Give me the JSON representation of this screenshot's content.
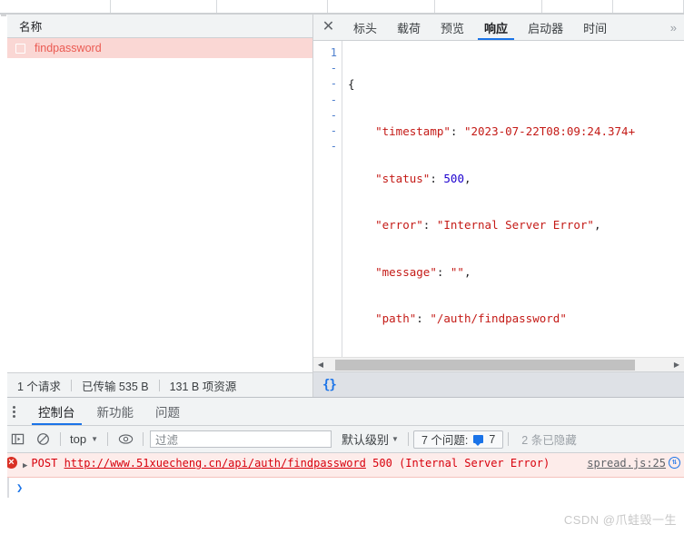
{
  "network_panel": {
    "request_list": {
      "column_header": "名称",
      "rows": [
        {
          "name": "findpassword",
          "icon": "document-icon",
          "selected": true
        }
      ]
    },
    "status_bar": {
      "requests": "1 个请求",
      "transferred": "已传输 535 B",
      "resources": "131 B 项资源"
    },
    "detail_tabs": {
      "close_icon": "✕",
      "items": [
        {
          "label": "标头",
          "active": false
        },
        {
          "label": "载荷",
          "active": false
        },
        {
          "label": "预览",
          "active": false
        },
        {
          "label": "响应",
          "active": true
        },
        {
          "label": "启动器",
          "active": false
        },
        {
          "label": "时间",
          "active": false
        }
      ],
      "overflow_label": "»"
    },
    "response_body": {
      "line_numbers": [
        "1",
        "-",
        "-",
        "-",
        "-",
        "-",
        "-"
      ],
      "lines": [
        {
          "indent": 0,
          "text": "{",
          "type": "punct"
        },
        {
          "indent": 1,
          "key": "\"timestamp\"",
          "value": "\"2023-07-22T08:09:24.374+",
          "value_type": "string",
          "trailing": ""
        },
        {
          "indent": 1,
          "key": "\"status\"",
          "value": "500",
          "value_type": "number",
          "trailing": ","
        },
        {
          "indent": 1,
          "key": "\"error\"",
          "value": "\"Internal Server Error\"",
          "value_type": "string",
          "trailing": ","
        },
        {
          "indent": 1,
          "key": "\"message\"",
          "value": "\"\"",
          "value_type": "string",
          "trailing": ","
        },
        {
          "indent": 1,
          "key": "\"path\"",
          "value": "\"/auth/findpassword\"",
          "value_type": "string",
          "trailing": ""
        },
        {
          "indent": 0,
          "text": "}",
          "type": "punct"
        }
      ],
      "footer_icon": "{}"
    }
  },
  "drawer": {
    "menu_icon": "kebab-menu-icon",
    "tabs": [
      {
        "label": "控制台",
        "active": true
      },
      {
        "label": "新功能",
        "active": false
      },
      {
        "label": "问题",
        "active": false
      }
    ],
    "toolbar": {
      "sidebar_toggle_icon": "sidebar-toggle-icon",
      "clear_icon": "clear-console-icon",
      "context_label": "top",
      "eye_icon": "live-expression-icon",
      "filter_placeholder": "过滤",
      "filter_value": "",
      "level_label": "默认级别",
      "issues_label": "7 个问题:",
      "issues_count": "7",
      "hidden_label": "2 条已隐藏"
    },
    "messages": [
      {
        "severity": "error",
        "icon": "error-icon",
        "disclosure": "▶",
        "method": "POST",
        "url": "http://www.51xuecheng.cn/api/auth/findpassword",
        "status": "500",
        "status_text": "(Internal Server Error)",
        "source": "spread.js:25",
        "network_icon": "network-request-icon"
      }
    ],
    "prompt_caret": "❯"
  },
  "watermark": "CSDN @爪蛙毁一生",
  "colors": {
    "accent_blue": "#1a73e8",
    "error_red": "#d8000c",
    "selected_row_bg": "#fad7d4",
    "selected_row_text": "#eb5b53",
    "toolbar_bg": "#f1f3f4",
    "json_string": "#c41a16",
    "json_number": "#1c00cf"
  }
}
